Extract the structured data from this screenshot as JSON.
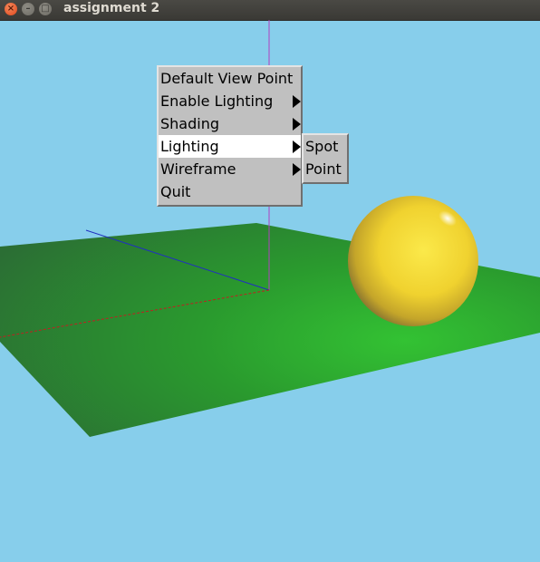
{
  "window": {
    "title": "assignment 2",
    "close_glyph": "×",
    "minimize_glyph": "–",
    "maximize_glyph": "□"
  },
  "scene": {
    "background_color": "#87CEEB",
    "floor_color": "#2DB82D",
    "sphere_color": "#F5D832",
    "axis_colors": {
      "x": "#c02020",
      "y": "#b040c0",
      "z": "#2020c0"
    }
  },
  "context_menu": {
    "items": [
      {
        "label": "Default View Point",
        "has_submenu": false
      },
      {
        "label": "Enable Lighting",
        "has_submenu": true
      },
      {
        "label": "Shading",
        "has_submenu": true
      },
      {
        "label": "Lighting",
        "has_submenu": true,
        "active": true
      },
      {
        "label": "Wireframe",
        "has_submenu": true
      },
      {
        "label": "Quit",
        "has_submenu": false
      }
    ],
    "submenu": {
      "items": [
        {
          "label": "Spot"
        },
        {
          "label": "Point"
        }
      ]
    }
  }
}
